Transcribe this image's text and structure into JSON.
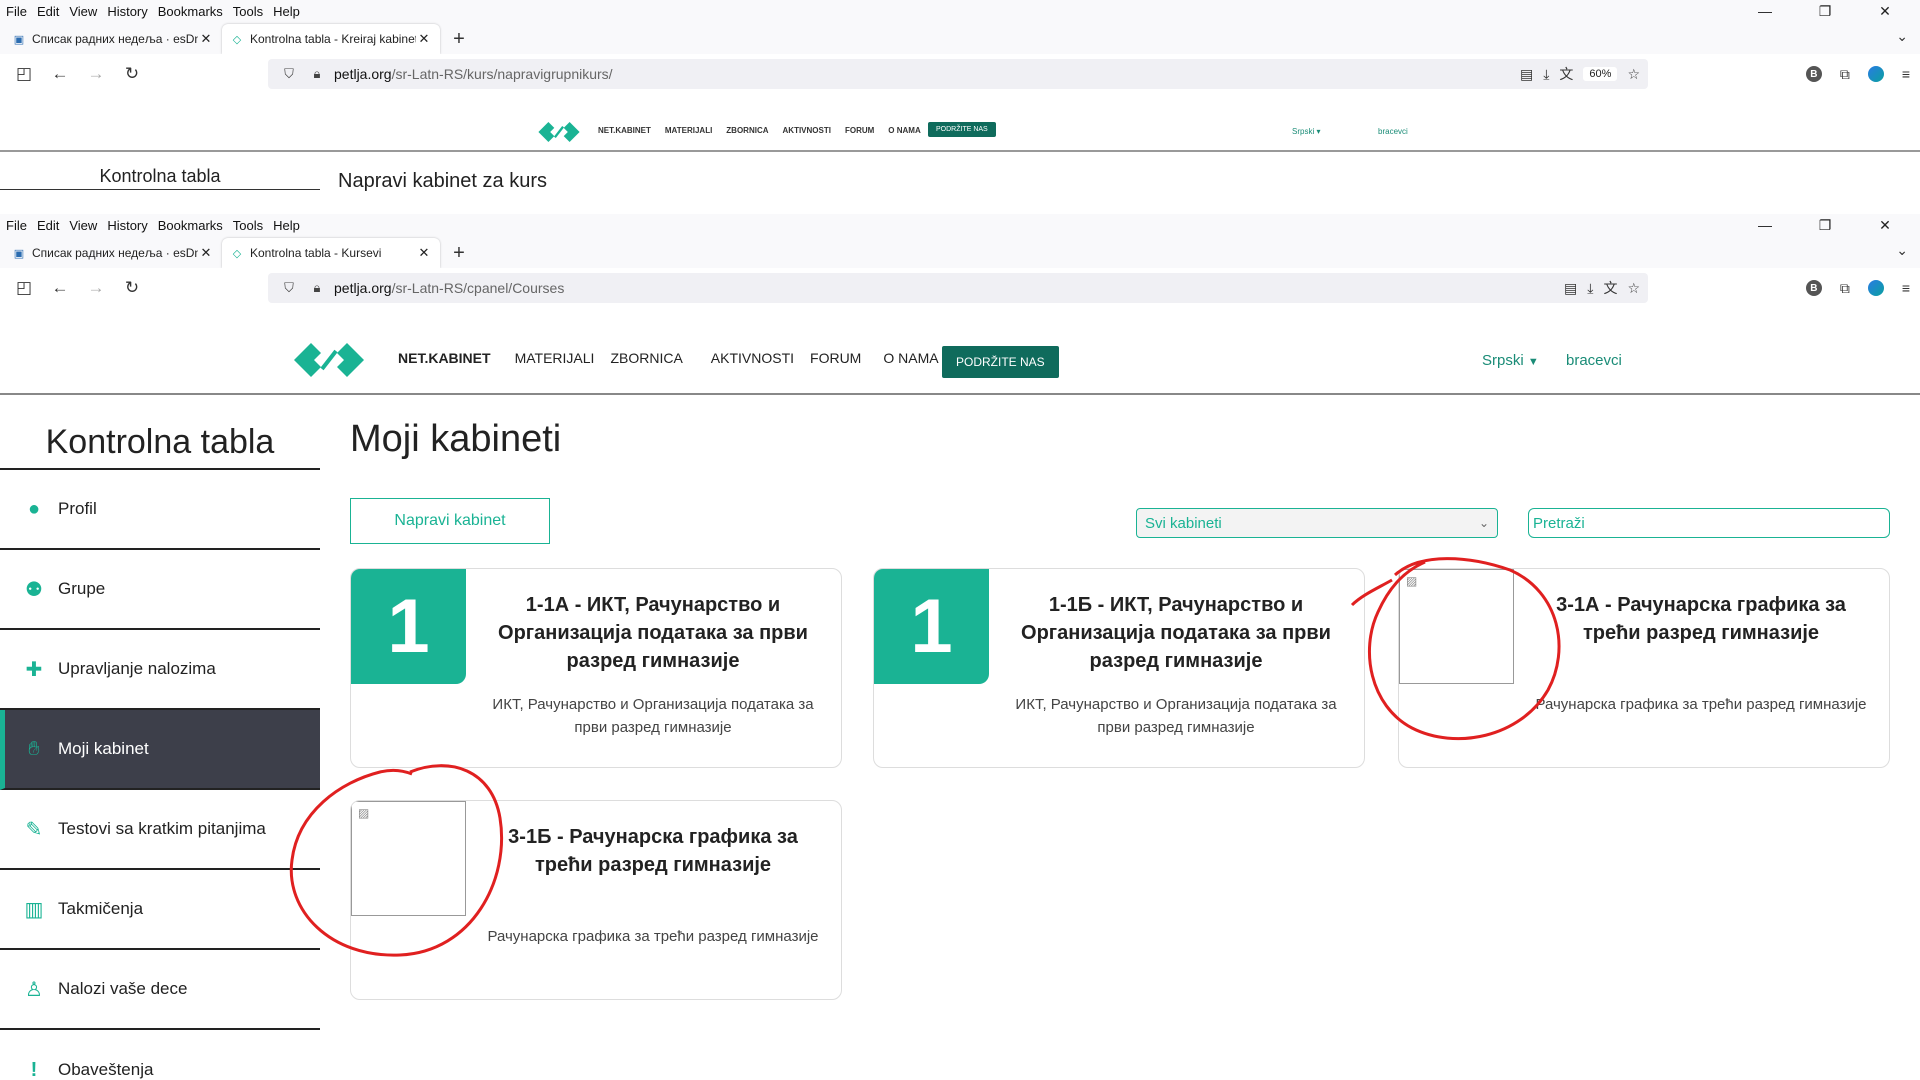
{
  "browser_back": {
    "menu": [
      "File",
      "Edit",
      "View",
      "History",
      "Bookmarks",
      "Tools",
      "Help"
    ],
    "tabs": [
      {
        "title": "Списак радних недеља · esDne"
      },
      {
        "title": "Kontrolna tabla - Kreiraj kabinet"
      }
    ],
    "url_host": "petlja.org",
    "url_path": "/sr-Latn-RS/kurs/napravigrupnikurs/",
    "zoom": "60%"
  },
  "mini_site": {
    "nav": [
      "NET.KABINET",
      "MATERIJALI",
      "ZBORNICA",
      "AKTIVNOSTI",
      "FORUM",
      "O NAMA"
    ],
    "support": "PODRŽITE NAS",
    "lang": "Srpski ▾",
    "user": "bracevci",
    "side_title": "Kontrolna tabla",
    "page_title": "Napravi kabinet za kurs"
  },
  "browser_front": {
    "menu": [
      "File",
      "Edit",
      "View",
      "History",
      "Bookmarks",
      "Tools",
      "Help"
    ],
    "tabs": [
      {
        "title": "Списак радних недеља · esDne"
      },
      {
        "title": "Kontrolna tabla - Kursevi"
      }
    ],
    "url_host": "petlja.org",
    "url_path": "/sr-Latn-RS/cpanel/Courses"
  },
  "site": {
    "nav": [
      "NET.KABINET",
      "MATERIJALI",
      "ZBORNICA",
      "AKTIVNOSTI",
      "FORUM",
      "O NAMA"
    ],
    "support": "PODRŽITE NAS",
    "lang": "Srpski",
    "user": "bracevci"
  },
  "sidebar": {
    "title": "Kontrolna tabla",
    "items": [
      {
        "label": "Profil",
        "icon": "user-icon"
      },
      {
        "label": "Grupe",
        "icon": "users-icon"
      },
      {
        "label": "Upravljanje nalozima",
        "icon": "user-plus-icon"
      },
      {
        "label": "Moji kabinet",
        "icon": "hand-icon",
        "active": true
      },
      {
        "label": "Testovi sa kratkim pitanjima",
        "icon": "edit-icon"
      },
      {
        "label": "Takmičenja",
        "icon": "chart-icon"
      },
      {
        "label": "Nalozi vaše dece",
        "icon": "child-icon"
      },
      {
        "label": "Obaveštenja",
        "icon": "exclamation-icon"
      }
    ]
  },
  "main": {
    "title": "Moji kabineti",
    "create_button": "Napravi kabinet",
    "filter": "Svi kabineti",
    "search_placeholder": "Pretraži",
    "cards": [
      {
        "thumb": "1",
        "title": "1-1А - ИКТ, Рачунарство и Организација података за први разред гимназије",
        "desc": "ИКТ, Рачунарство и Организација података за први разред гимназије"
      },
      {
        "thumb": "1",
        "title": "1-1Б - ИКТ, Рачунарство и Организација података за први разред гимназије",
        "desc": "ИКТ, Рачунарство и Организација података за први разред гимназије"
      },
      {
        "thumb": "",
        "title": "3-1А - Рачунарска графика за трећи разред гимназије",
        "desc": "Рачунарска графика за трећи разред гимназије"
      },
      {
        "thumb": "",
        "title": "3-1Б - Рачунарска графика за трећи разред гимназије",
        "desc": "Рачунарска графика за трећи разред гимназије"
      }
    ]
  },
  "colors": {
    "accent": "#1ab394",
    "support": "#0f6b5c",
    "active_bg": "#3d3f4a",
    "annotation": "#e02020"
  }
}
